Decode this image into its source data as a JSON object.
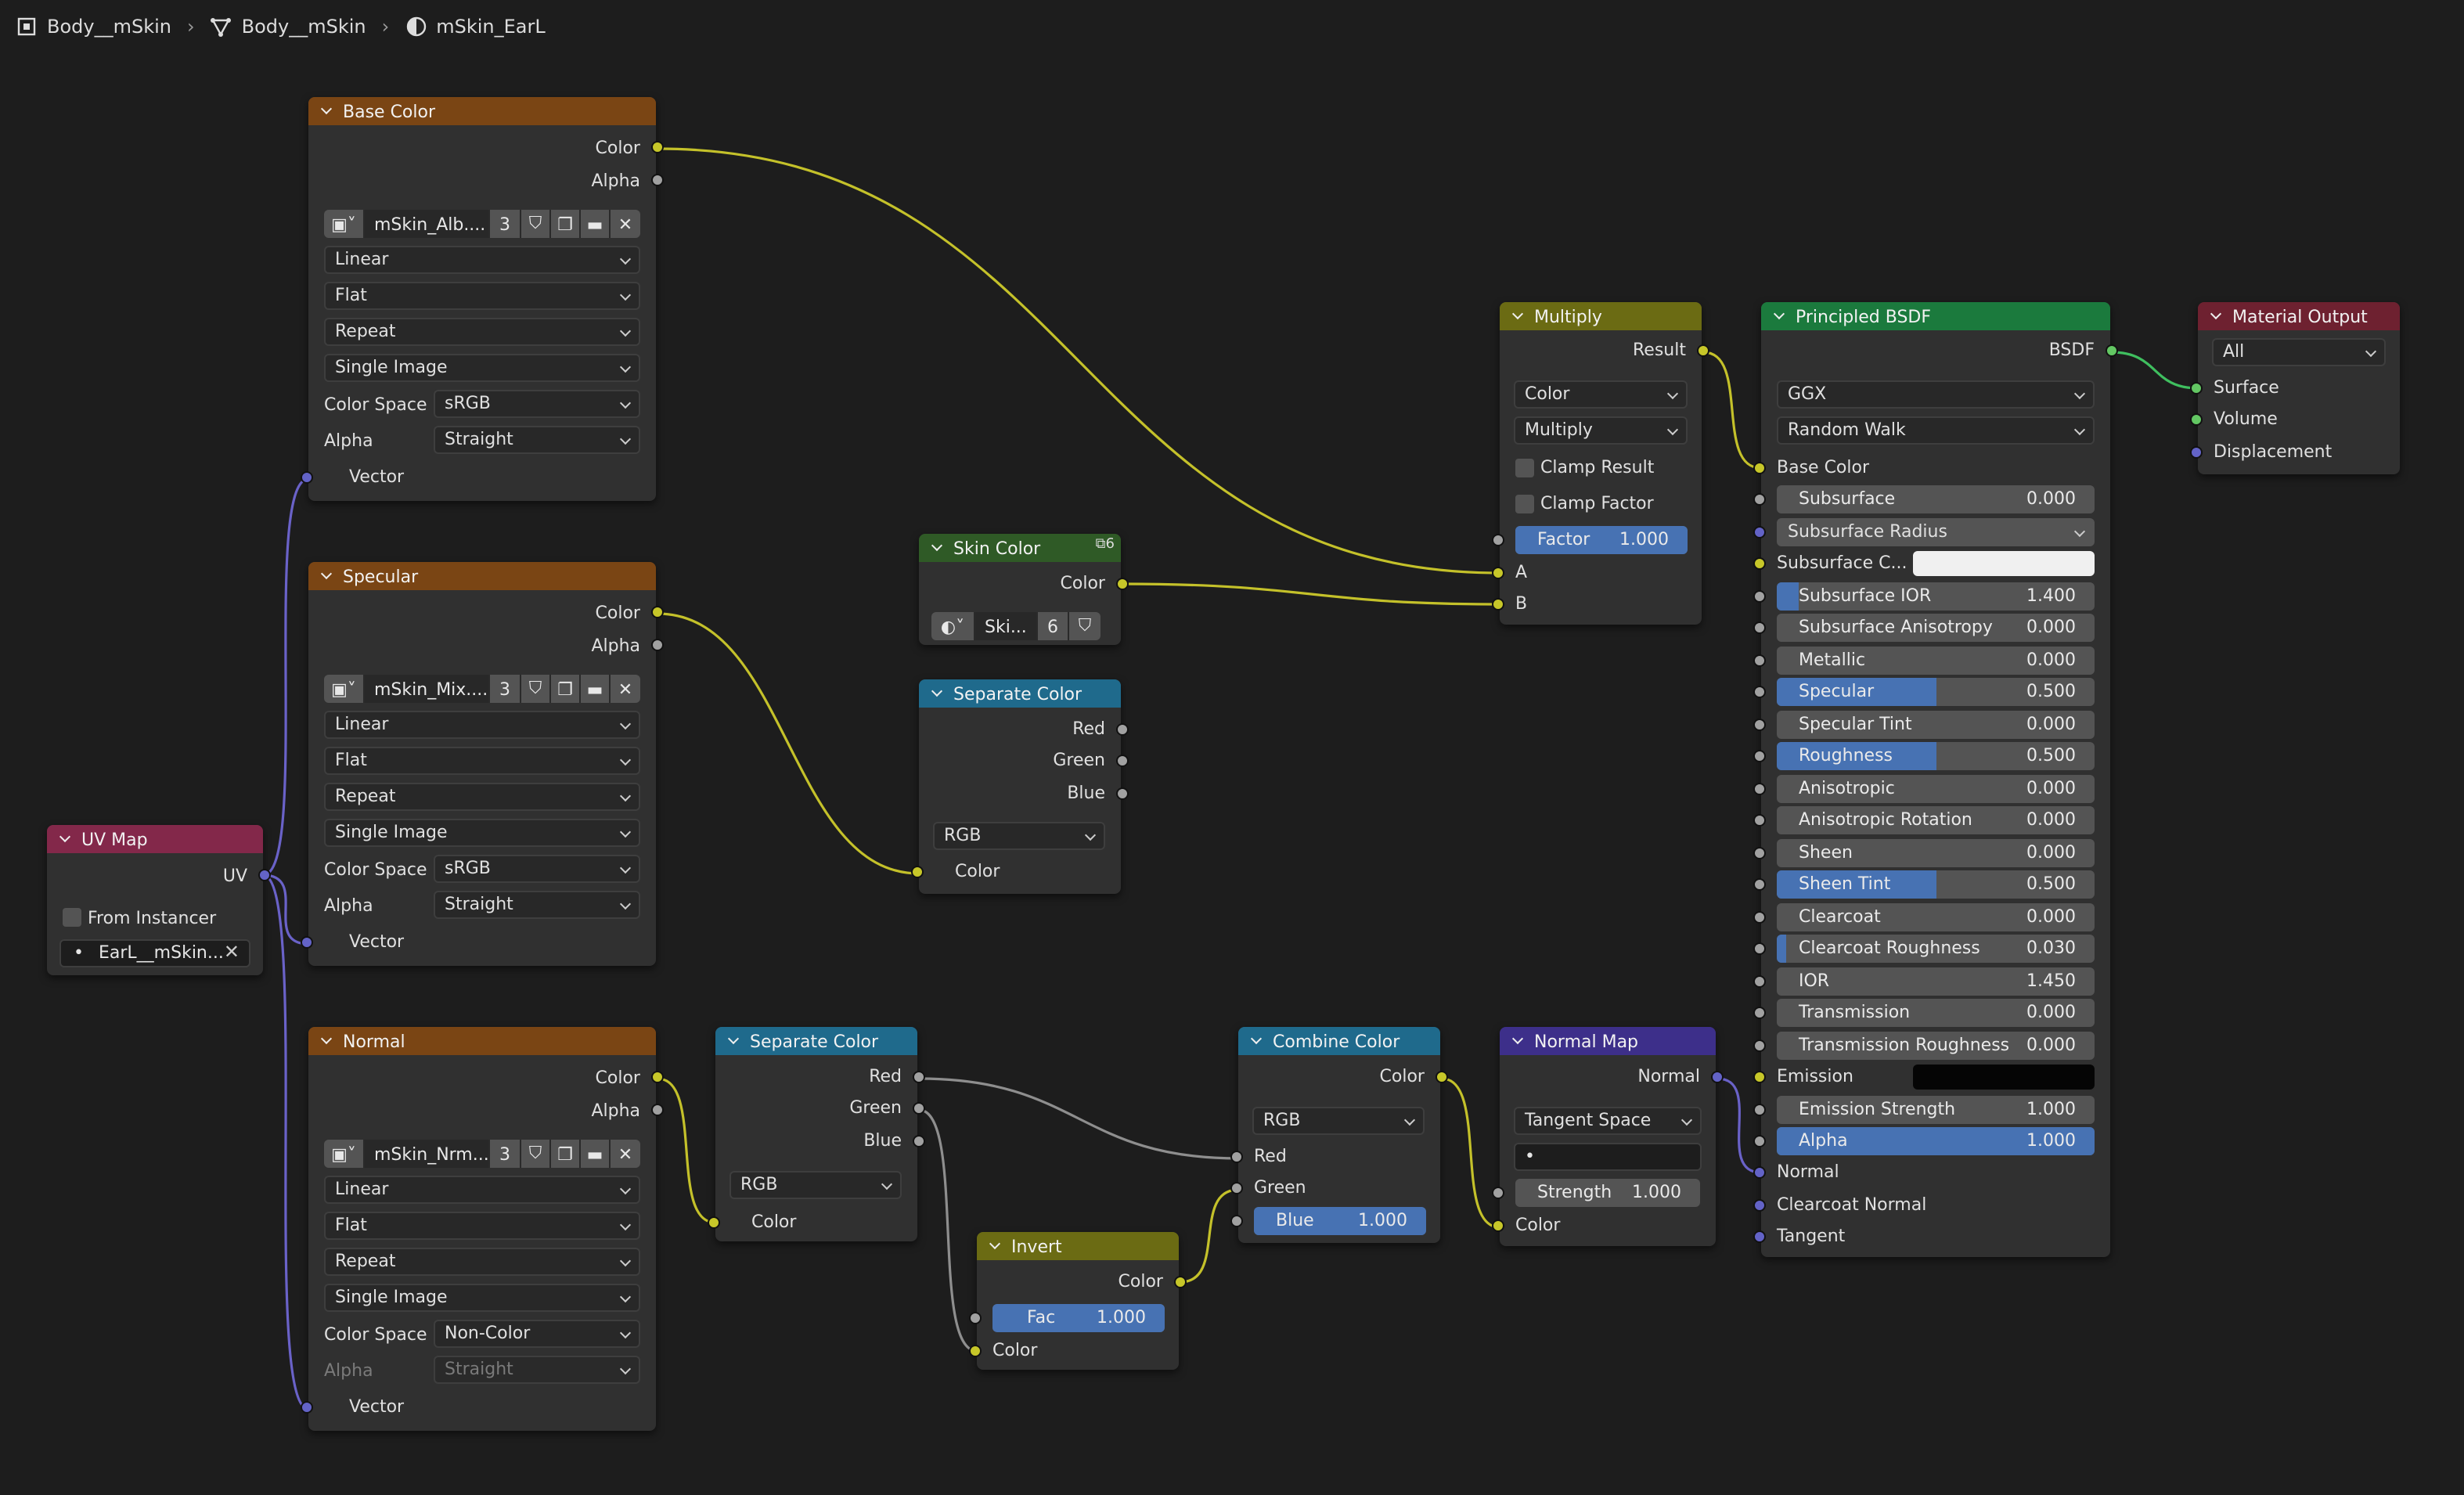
{
  "breadcrumb": {
    "object": "Body__mSkin",
    "mesh": "Body__mSkin",
    "material": "mSkin_EarL"
  },
  "colors": {
    "texture_header": "#7a4514",
    "uv_header": "#83284a",
    "converter_header": "#1f6a8c",
    "color_header": "#6b6b13",
    "group_header": "#2f5a26",
    "shader_header": "#1b7a3d",
    "output_header": "#6e2130",
    "vector_header": "#3d2f8a",
    "socket_color": "#c7c729",
    "socket_float": "#a1a1a1",
    "socket_vector": "#6363c7",
    "socket_shader": "#63c763",
    "slider_fill": "#4772b3"
  },
  "nodes": {
    "base_color": {
      "title": "Base Color",
      "out_color": "Color",
      "out_alpha": "Alpha",
      "image_name": "mSkin_Alb....",
      "users": "3",
      "interpolation": "Linear",
      "projection": "Flat",
      "extension": "Repeat",
      "source": "Single Image",
      "color_space_label": "Color Space",
      "color_space": "sRGB",
      "alpha_label": "Alpha",
      "alpha": "Straight",
      "in_vector": "Vector"
    },
    "specular": {
      "title": "Specular",
      "out_color": "Color",
      "out_alpha": "Alpha",
      "image_name": "mSkin_Mix....",
      "users": "3",
      "interpolation": "Linear",
      "projection": "Flat",
      "extension": "Repeat",
      "source": "Single Image",
      "color_space_label": "Color Space",
      "color_space": "sRGB",
      "alpha_label": "Alpha",
      "alpha": "Straight",
      "in_vector": "Vector"
    },
    "normal": {
      "title": "Normal",
      "out_color": "Color",
      "out_alpha": "Alpha",
      "image_name": "mSkin_Nrm....",
      "users": "3",
      "interpolation": "Linear",
      "projection": "Flat",
      "extension": "Repeat",
      "source": "Single Image",
      "color_space_label": "Color Space",
      "color_space": "Non-Color",
      "alpha_label": "Alpha",
      "alpha": "Straight",
      "in_vector": "Vector"
    },
    "uv_map": {
      "title": "UV Map",
      "out_uv": "UV",
      "from_instancer": "From Instancer",
      "uv_name": "EarL__mSkin..."
    },
    "skin_color": {
      "title": "Skin Color",
      "header_users": "6",
      "out_color": "Color",
      "group_name": "Ski...",
      "users": "6"
    },
    "sep_color_1": {
      "title": "Separate Color",
      "out_red": "Red",
      "out_green": "Green",
      "out_blue": "Blue",
      "mode": "RGB",
      "in_color": "Color"
    },
    "sep_color_2": {
      "title": "Separate Color",
      "out_red": "Red",
      "out_green": "Green",
      "out_blue": "Blue",
      "mode": "RGB",
      "in_color": "Color"
    },
    "invert": {
      "title": "Invert",
      "out_color": "Color",
      "fac_label": "Fac",
      "fac": "1.000",
      "in_color": "Color"
    },
    "combine_color": {
      "title": "Combine Color",
      "out_color": "Color",
      "mode": "RGB",
      "in_red": "Red",
      "in_green": "Green",
      "blue_label": "Blue",
      "blue": "1.000"
    },
    "normal_map": {
      "title": "Normal Map",
      "out_normal": "Normal",
      "space": "Tangent Space",
      "uv_bullet": "•",
      "strength_label": "Strength",
      "strength": "1.000",
      "in_color": "Color"
    },
    "multiply": {
      "title": "Multiply",
      "out_result": "Result",
      "data_type": "Color",
      "blend": "Multiply",
      "clamp_result": "Clamp Result",
      "clamp_factor": "Clamp Factor",
      "factor_label": "Factor",
      "factor": "1.000",
      "in_a": "A",
      "in_b": "B"
    },
    "principled": {
      "title": "Principled BSDF",
      "out_bsdf": "BSDF",
      "distribution": "GGX",
      "subsurface_method": "Random Walk",
      "base_color": "Base Color",
      "subsurface_radius": "Subsurface Radius",
      "subsurface_color": "Subsurface C...",
      "emission": "Emission",
      "normal": "Normal",
      "clearcoat_normal": "Clearcoat Normal",
      "tangent": "Tangent",
      "sliders": [
        {
          "label": "Subsurface",
          "value": "0.000",
          "fill": 0
        },
        {
          "label": "Subsurface IOR",
          "value": "1.400",
          "fill": 0.07
        },
        {
          "label": "Subsurface Anisotropy",
          "value": "0.000",
          "fill": 0
        },
        {
          "label": "Metallic",
          "value": "0.000",
          "fill": 0
        },
        {
          "label": "Specular",
          "value": "0.500",
          "fill": 0.5
        },
        {
          "label": "Specular Tint",
          "value": "0.000",
          "fill": 0
        },
        {
          "label": "Roughness",
          "value": "0.500",
          "fill": 0.5
        },
        {
          "label": "Anisotropic",
          "value": "0.000",
          "fill": 0
        },
        {
          "label": "Anisotropic Rotation",
          "value": "0.000",
          "fill": 0
        },
        {
          "label": "Sheen",
          "value": "0.000",
          "fill": 0
        },
        {
          "label": "Sheen Tint",
          "value": "0.500",
          "fill": 0.5
        },
        {
          "label": "Clearcoat",
          "value": "0.000",
          "fill": 0
        },
        {
          "label": "Clearcoat Roughness",
          "value": "0.030",
          "fill": 0.03
        },
        {
          "label": "IOR",
          "value": "1.450",
          "fill": 0
        },
        {
          "label": "Transmission",
          "value": "0.000",
          "fill": 0
        },
        {
          "label": "Transmission Roughness",
          "value": "0.000",
          "fill": 0
        }
      ],
      "emission_strength_label": "Emission Strength",
      "emission_strength": "1.000",
      "alpha_label": "Alpha",
      "alpha": "1.000",
      "alpha_fill": 1
    },
    "material_output": {
      "title": "Material Output",
      "target": "All",
      "in_surface": "Surface",
      "in_volume": "Volume",
      "in_displacement": "Displacement"
    }
  }
}
